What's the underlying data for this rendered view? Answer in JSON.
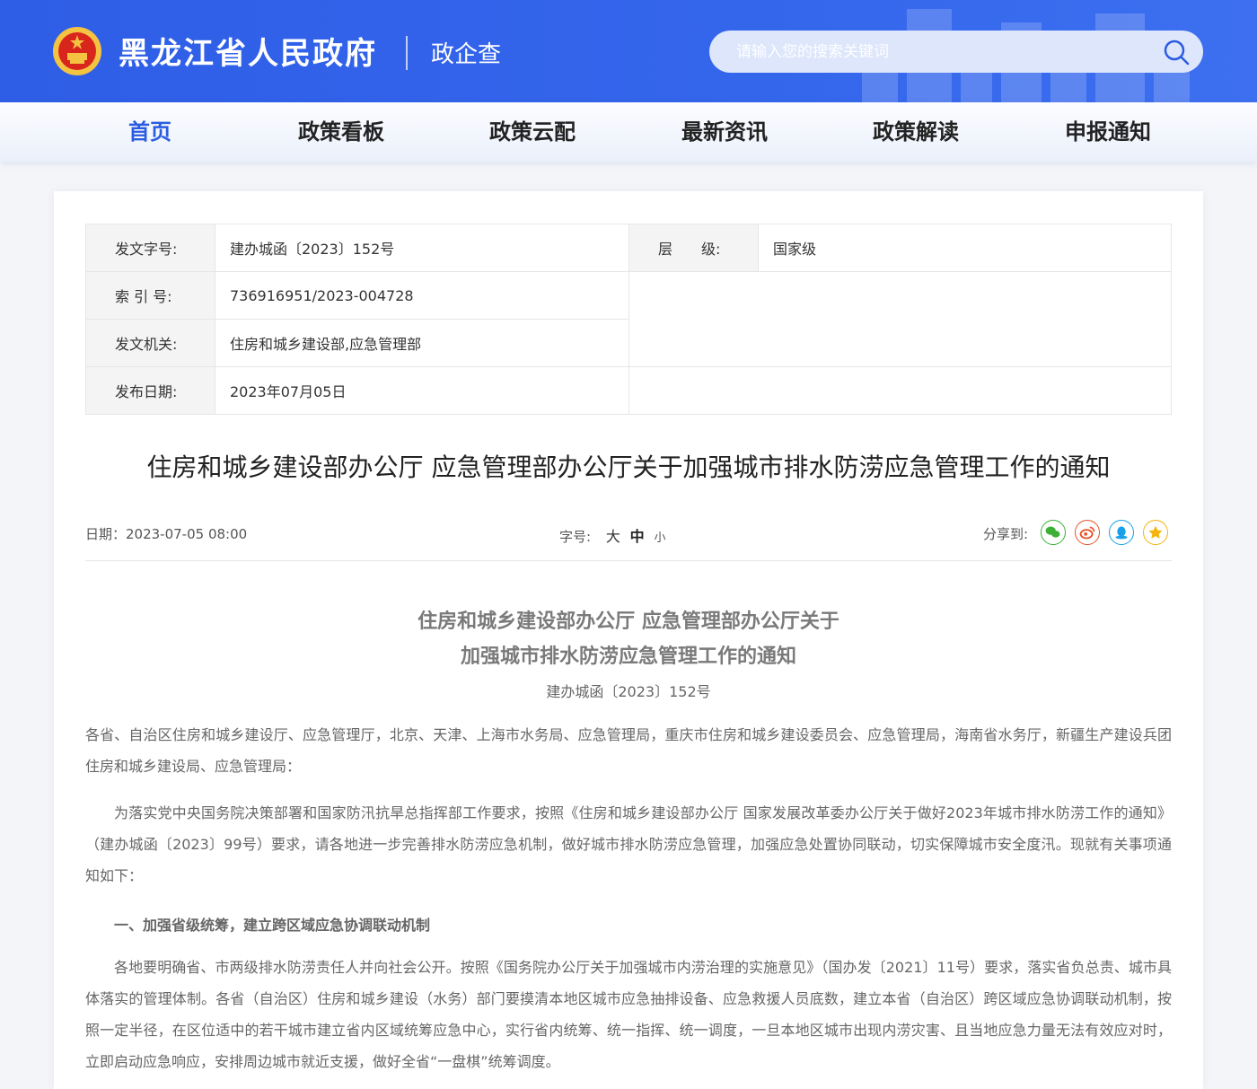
{
  "header": {
    "site_title": "黑龙江省人民政府",
    "sub_title": "政企查",
    "search_placeholder": "请输入您的搜索关键词"
  },
  "nav": [
    {
      "label": "首页",
      "active": true
    },
    {
      "label": "政策看板"
    },
    {
      "label": "政策云配"
    },
    {
      "label": "最新资讯"
    },
    {
      "label": "政策解读"
    },
    {
      "label": "申报通知"
    }
  ],
  "meta": {
    "doc_no_label": "发文字号:",
    "doc_no": "建办城函〔2023〕152号",
    "level_label": "层　　级:",
    "level": "国家级",
    "index_label": "索 引 号:",
    "index": "736916951/2023-004728",
    "issuer_label": "发文机关:",
    "issuer": "住房和城乡建设部,应急管理部",
    "date_label": "发布日期:",
    "date": "2023年07月05日"
  },
  "article": {
    "title": "住房和城乡建设部办公厅 应急管理部办公厅关于加强城市排水防涝应急管理工作的通知",
    "date_line": "日期：2023-07-05 08:00",
    "font_label": "字号:",
    "font_big": "大",
    "font_mid": "中",
    "font_small": "小",
    "share_label": "分享到:",
    "body_title_1": "住房和城乡建设部办公厅 应急管理部办公厅关于",
    "body_title_2": "加强城市排水防涝应急管理工作的通知",
    "body_docno": "建办城函〔2023〕152号",
    "addressee": "各省、自治区住房和城乡建设厅、应急管理厅，北京、天津、上海市水务局、应急管理局，重庆市住房和城乡建设委员会、应急管理局，海南省水务厅，新疆生产建设兵团住房和城乡建设局、应急管理局：",
    "intro": "为落实党中央国务院决策部署和国家防汛抗旱总指挥部工作要求，按照《住房和城乡建设部办公厅 国家发展改革委办公厅关于做好2023年城市排水防涝工作的通知》（建办城函〔2023〕99号）要求，请各地进一步完善排水防涝应急机制，做好城市排水防涝应急管理，加强应急处置协同联动，切实保障城市安全度汛。现就有关事项通知如下：",
    "section1": "一、加强省级统筹，建立跨区域应急协调联动机制",
    "section1_text": "各地要明确省、市两级排水防涝责任人并向社会公开。按照《国务院办公厅关于加强城市内涝治理的实施意见》（国办发〔2021〕11号）要求，落实省负总责、城市具体落实的管理体制。各省（自治区）住房和城乡建设（水务）部门要摸清本地区城市应急抽排设备、应急救援人员底数，建立本省（自治区）跨区域应急协调联动机制，按照一定半径，在区位适中的若干城市建立省内区域统筹应急中心，实行省内统筹、统一指挥、统一调度，一旦本地区城市出现内涝灾害、且当地应急力量无法有效应对时，立即启动应急响应，安排周边城市就近支援，做好全省“一盘棋”统筹调度。"
  },
  "colors": {
    "header_blue": "#2f5ee6",
    "nav_active": "#2b5ce0",
    "wechat": "#3cb034",
    "weibo": "#e8542a",
    "qq": "#1aa0e8",
    "qzone": "#f5b40c"
  }
}
